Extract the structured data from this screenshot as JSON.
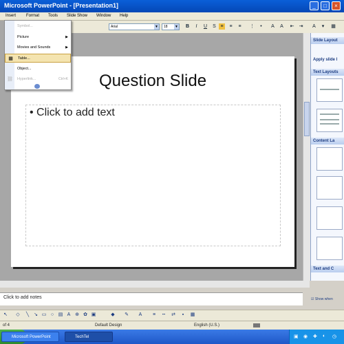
{
  "window": {
    "title": "Microsoft PowerPoint - [Presentation1]"
  },
  "menubar": {
    "items": [
      "Insert",
      "Format",
      "Tools",
      "Slide Show",
      "Window",
      "Help"
    ]
  },
  "insert_menu": {
    "items": [
      {
        "label": "Symbol...",
        "enabled": false
      },
      {
        "label": "Picture",
        "enabled": true,
        "submenu": true
      },
      {
        "label": "Movies and Sounds",
        "enabled": true,
        "submenu": true
      },
      {
        "label": "Table...",
        "enabled": true,
        "highlighted": true
      },
      {
        "label": "Object...",
        "enabled": true
      },
      {
        "label": "Hyperlink...",
        "shortcut": "Ctrl+K",
        "enabled": false
      }
    ]
  },
  "toolbar": {
    "font_name": "Arial",
    "font_size": "18"
  },
  "slide": {
    "title": "Question Slide",
    "body_placeholder": "Click to add text"
  },
  "task_pane": {
    "title": "Slide Layout",
    "apply_label": "Apply slide l",
    "sections": [
      "Text Layouts",
      "Content La",
      "Text and C"
    ],
    "show_when_label": "Show when"
  },
  "notes": {
    "placeholder": "Click to add notes"
  },
  "status": {
    "slide_count": "of 4",
    "design": "Default Design",
    "language": "English (U.S.)"
  },
  "taskbar": {
    "items": [
      "Microsoft PowerPoint",
      "TechTel"
    ]
  },
  "colors": {
    "titlebar": "#0a5fd8",
    "menu_highlight": "#f4e4b0",
    "taskbar": "#3a7ae6"
  }
}
